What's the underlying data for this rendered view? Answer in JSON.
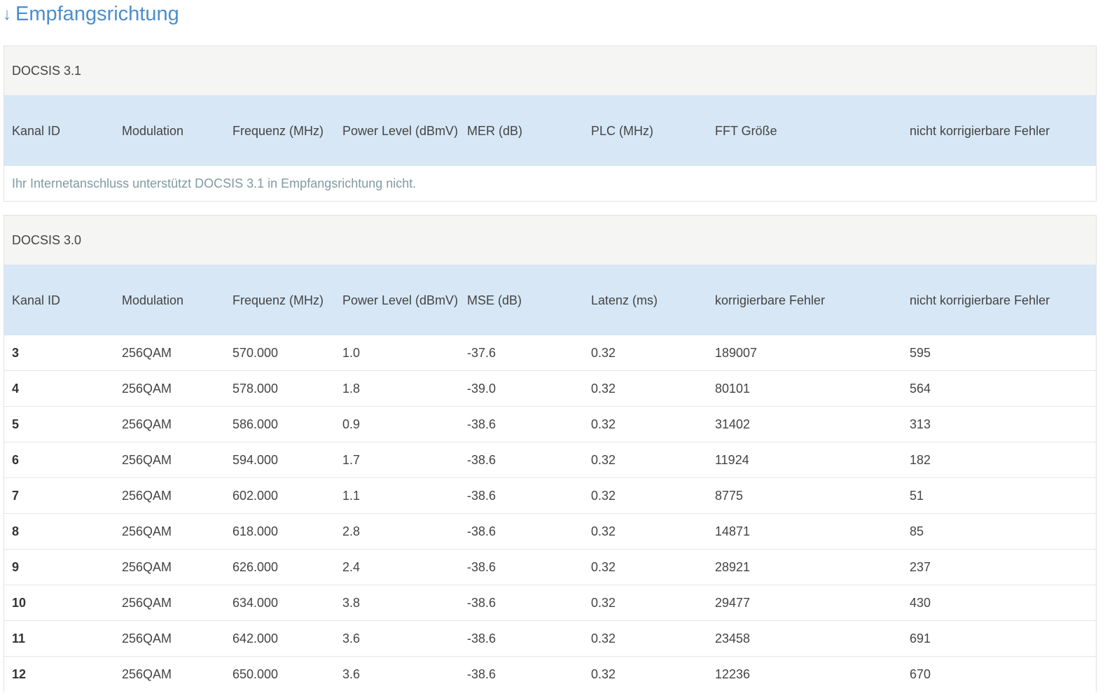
{
  "heading": {
    "arrow": "↓",
    "title": "Empfangsrichtung"
  },
  "docsis31": {
    "title": "DOCSIS 3.1",
    "columns": [
      "Kanal ID",
      "Modulation",
      "Frequenz (MHz)",
      "Power Level (dBmV)",
      "MER (dB)",
      "PLC (MHz)",
      "FFT Größe",
      "nicht korrigierbare Fehler"
    ],
    "empty_message": "Ihr Internetanschluss unterstützt DOCSIS 3.1 in Empfangsrichtung nicht."
  },
  "docsis30": {
    "title": "DOCSIS 3.0",
    "columns": [
      "Kanal ID",
      "Modulation",
      "Frequenz (MHz)",
      "Power Level (dBmV)",
      "MSE (dB)",
      "Latenz (ms)",
      "korrigierbare Fehler",
      "nicht korrigierbare Fehler"
    ],
    "rows": [
      [
        "3",
        "256QAM",
        "570.000",
        "1.0",
        "-37.6",
        "0.32",
        "189007",
        "595"
      ],
      [
        "4",
        "256QAM",
        "578.000",
        "1.8",
        "-39.0",
        "0.32",
        "80101",
        "564"
      ],
      [
        "5",
        "256QAM",
        "586.000",
        "0.9",
        "-38.6",
        "0.32",
        "31402",
        "313"
      ],
      [
        "6",
        "256QAM",
        "594.000",
        "1.7",
        "-38.6",
        "0.32",
        "11924",
        "182"
      ],
      [
        "7",
        "256QAM",
        "602.000",
        "1.1",
        "-38.6",
        "0.32",
        "8775",
        "51"
      ],
      [
        "8",
        "256QAM",
        "618.000",
        "2.8",
        "-38.6",
        "0.32",
        "14871",
        "85"
      ],
      [
        "9",
        "256QAM",
        "626.000",
        "2.4",
        "-38.6",
        "0.32",
        "28921",
        "237"
      ],
      [
        "10",
        "256QAM",
        "634.000",
        "3.8",
        "-38.6",
        "0.32",
        "29477",
        "430"
      ],
      [
        "11",
        "256QAM",
        "642.000",
        "3.6",
        "-38.6",
        "0.32",
        "23458",
        "691"
      ],
      [
        "12",
        "256QAM",
        "650.000",
        "3.6",
        "-38.6",
        "0.32",
        "12236",
        "670"
      ]
    ]
  }
}
